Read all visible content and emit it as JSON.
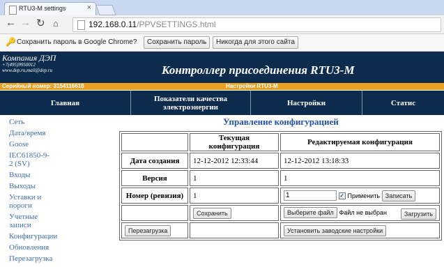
{
  "browser": {
    "tab_title": "RTU3-M settings",
    "tab_close": "×",
    "url_host": "192.168.0.11",
    "url_path": "/PPVSETTINGS.html"
  },
  "infobar": {
    "message": "Сохранить пароль в Google Chrome?",
    "save_label": "Сохранить пароль",
    "never_label": "Никогда для этого сайта"
  },
  "header": {
    "company": "Компания ДЭП",
    "phone": "+7(495)9950012",
    "web": "www.dep.ru,mail@dep.ru",
    "title": "Контроллер присоединения RTU3-M",
    "serial": "Серийный номер: 3154116618",
    "settings_caption": "Настройки RTU3-M",
    "bg_color": "#0d2b4d",
    "accent_color": "#e8a020"
  },
  "nav": {
    "home": "Главная",
    "quality": "Показатели качества электроэнергии",
    "settings": "Настройки",
    "stats": "Статис"
  },
  "sidebar": {
    "items": [
      "Сеть",
      "Дата/время",
      "Goose",
      "IEC61850-9-2 (SV)",
      "Входы",
      "Выходы",
      "Уставки и пороги",
      "Учетные записи",
      "Конфигурации",
      "Обновления",
      "Перезагрузка"
    ]
  },
  "config": {
    "title": "Управление конфигурацией",
    "col_current": "Текущая конфигурация",
    "col_edit": "Редактируемая конфигурация",
    "row_created": "Дата создания",
    "created_current": "12-12-2012 12:33:44",
    "created_edit": "12-12-2012 13:18:33",
    "row_version": "Версия",
    "version_current": "1",
    "version_edit": "1",
    "row_revision": "Номер (ревизия)",
    "revision_current": "1",
    "revision_input": "1",
    "apply_label": "Применить",
    "apply_checked": true,
    "write_label": "Записать",
    "save_label": "Сохранить",
    "choose_file_label": "Выберите файл",
    "no_file_text": "Файл не выбран",
    "upload_label": "Загрузить",
    "reboot_label": "Перезагрузка",
    "factory_label": "Установить заводские настройки"
  }
}
